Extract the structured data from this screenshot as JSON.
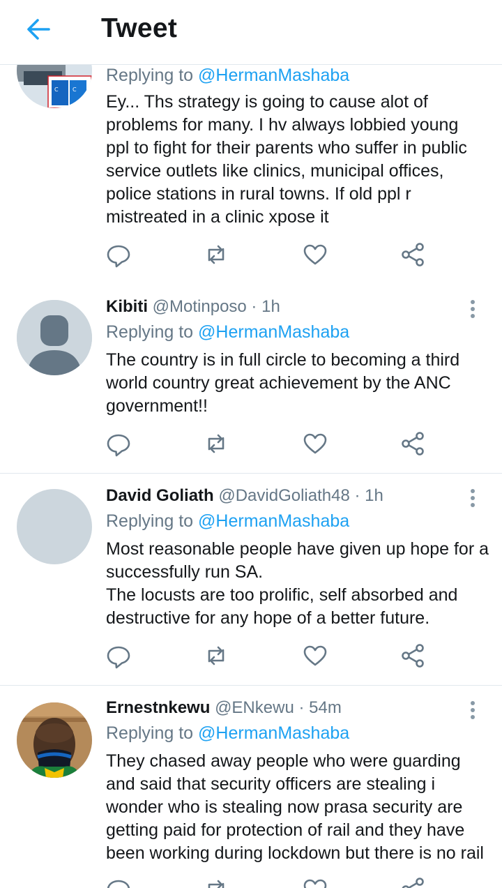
{
  "header": {
    "title": "Tweet",
    "back_icon": "arrow-left-icon"
  },
  "colors": {
    "accent": "#1da1f2",
    "secondary_text": "#657786",
    "divider": "#e1e8ed"
  },
  "tweets": [
    {
      "name": "",
      "handle": "",
      "time": "",
      "replying_label": "Replying to ",
      "replying_mention": "@HermanMashaba",
      "lines": [
        "Ey... Ths strategy is going to cause alot of",
        "problems for many.  I hv always lobbied young",
        "ppl to fight for their parents who suffer in public",
        "service outlets like clinics, municipal offices,",
        "police stations in rural towns. If old ppl r",
        "mistreated in a clinic xpose it"
      ]
    },
    {
      "name": "Kibiti",
      "handle": "@Motinposo · 1h",
      "replying_label": "Replying to ",
      "replying_mention": "@HermanMashaba",
      "lines": [
        "The country is in full circle to becoming a third",
        "world country great achievement by the ANC",
        "government!!"
      ]
    },
    {
      "name": "David Goliath",
      "handle": "@DavidGoliath48 · 1h",
      "replying_label": "Replying to ",
      "replying_mention": "@HermanMashaba",
      "lines": [
        "Most reasonable people have given up hope for a",
        "successfully run SA.",
        "The locusts are too prolific, self absorbed and",
        "destructive for any hope of a better future."
      ]
    },
    {
      "name": "Ernestnkewu",
      "handle": "@ENkewu · 54m",
      "replying_label": "Replying to ",
      "replying_mention": "@HermanMashaba",
      "lines": [
        "They chased away people who were guarding",
        "and said that security officers are stealing i",
        "wonder who is stealing now prasa security are",
        "getting paid for protection of rail and they have",
        "been working during lockdown but there is no rail"
      ]
    }
  ],
  "action_icons": [
    "reply-icon",
    "retweet-icon",
    "like-icon",
    "share-icon"
  ]
}
